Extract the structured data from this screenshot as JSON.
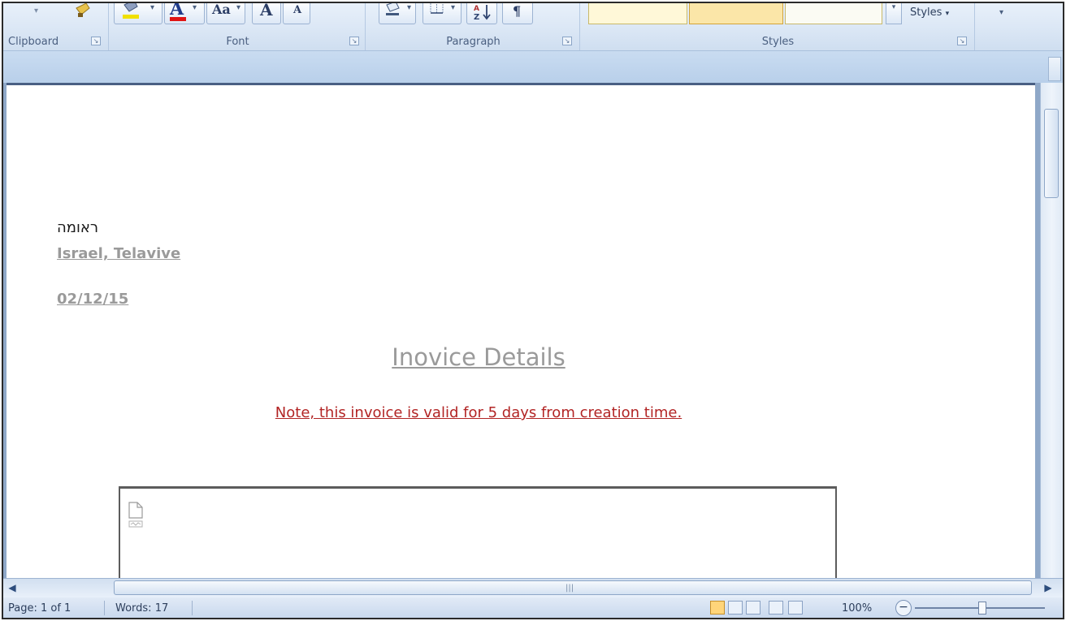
{
  "ribbon": {
    "groups": {
      "clipboard": {
        "label": "Clipboard"
      },
      "font": {
        "label": "Font",
        "size_grow_label": "A",
        "size_shrink_label": "A",
        "change_case_label": "Aa"
      },
      "paragraph": {
        "label": "Paragraph"
      },
      "styles": {
        "label": "Styles",
        "change_styles_label": "Styles"
      }
    }
  },
  "document": {
    "addressee_name": "ראומה",
    "addressee_city": "Israel, Telavive",
    "date": "02/12/15",
    "title": "Inovice Details",
    "note": "Note, this invoice is valid for 5 days from creation time."
  },
  "statusbar": {
    "page": "Page: 1 of 1",
    "words": "Words: 17",
    "zoom": "100%"
  },
  "colors": {
    "font_color_accent": "#e01414",
    "highlight_accent": "#f0e000",
    "note_text": "#b22424",
    "muted_text": "#9a9a9a"
  }
}
